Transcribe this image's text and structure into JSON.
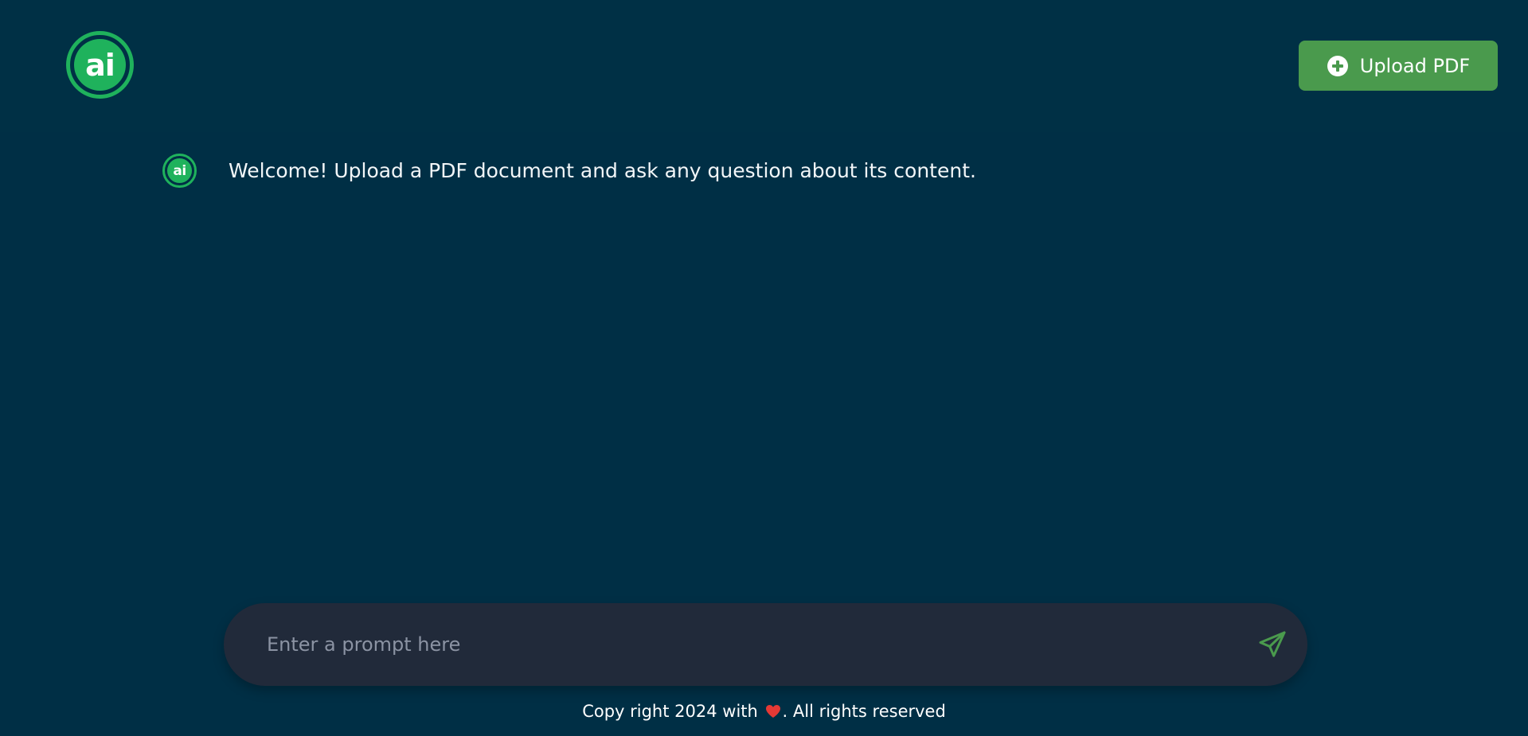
{
  "header": {
    "logo_text": "ai",
    "upload_button_label": "Upload PDF"
  },
  "chat": {
    "messages": [
      {
        "avatar_text": "ai",
        "text": "Welcome! Upload a PDF document and ask any question about its content."
      }
    ]
  },
  "prompt": {
    "value": "",
    "placeholder": "Enter a prompt here"
  },
  "footer": {
    "text_before": "Copy right 2024 with",
    "text_after": ". All rights reserved"
  },
  "icons": {
    "upload": "plus-circle-icon",
    "send": "paper-plane-icon",
    "footer": "heart-icon"
  },
  "colors": {
    "background": "#002f45",
    "header": "#003045",
    "accent_green": "#1fb25c",
    "button_green": "#4a9a4d",
    "input_bg": "#212a3a",
    "heart": "#e53935"
  }
}
